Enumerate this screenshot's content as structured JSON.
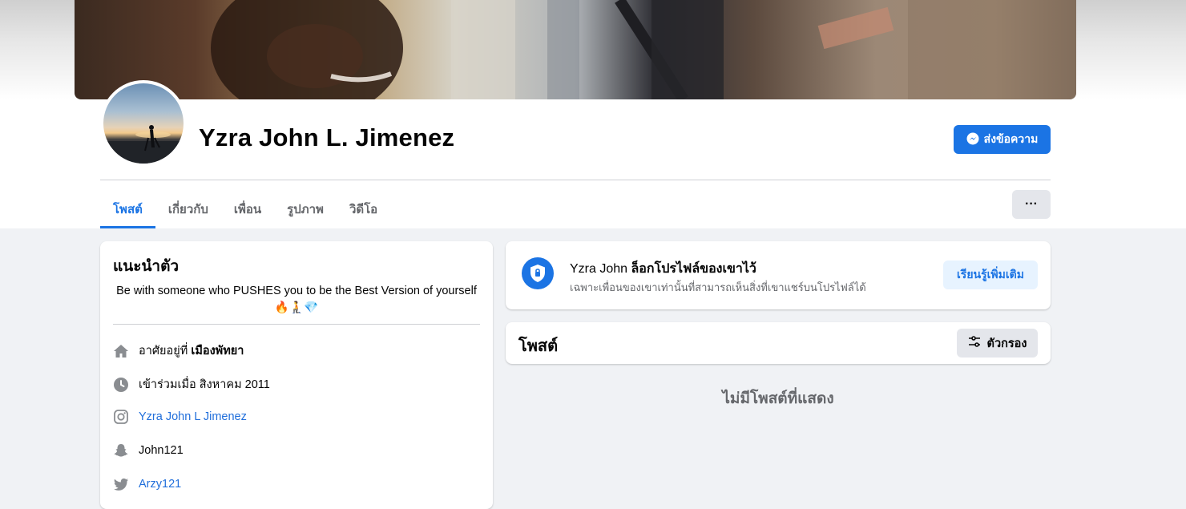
{
  "profile": {
    "name": "Yzra John L. Jimenez",
    "message_button": "ส่งข้อความ"
  },
  "tabs": [
    {
      "label": "โพสต์",
      "active": true
    },
    {
      "label": "เกี่ยวกับ"
    },
    {
      "label": "เพื่อน"
    },
    {
      "label": "รูปภาพ"
    },
    {
      "label": "วิดีโอ"
    }
  ],
  "more_button": "···",
  "intro": {
    "title": "แนะนำตัว",
    "bio": "Be with someone who PUSHES you to be the Best Version of yourself",
    "bio_emojis": "🔥🧎💎",
    "lives_in_prefix": "อาศัยอยู่ที่",
    "lives_in_place": "เมืองพัทยา",
    "joined": "เข้าร่วมเมื่อ สิงหาคม 2011",
    "instagram": "Yzra John L Jimenez",
    "snapchat": "John121",
    "twitter": "Arzy121"
  },
  "locked": {
    "name": "Yzra John",
    "title_suffix": "ล็อกโปรไฟล์ของเขาไว้",
    "subtitle": "เฉพาะเพื่อนของเขาเท่านั้นที่สามารถเห็นสิ่งที่เขาแชร์บนโปรไฟล์ได้",
    "learn_more": "เรียนรู้เพิ่มเติม"
  },
  "posts": {
    "title": "โพสต์",
    "filter_button": "ตัวกรอง",
    "empty_text": "ไม่มีโพสต์ที่แสดง"
  },
  "colors": {
    "accent": "#1b74e4",
    "background": "#f0f2f5",
    "secondary_text": "#65676b"
  },
  "icons": [
    "messenger-icon",
    "home-icon",
    "clock-icon",
    "instagram-icon",
    "snapchat-icon",
    "twitter-icon",
    "shield-lock-icon",
    "filter-icon"
  ]
}
